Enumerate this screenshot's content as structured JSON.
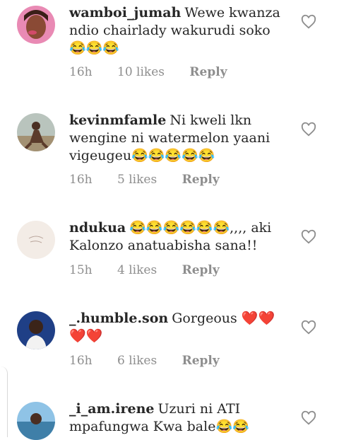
{
  "icons": {
    "like": "heart-outline-icon"
  },
  "comments": [
    {
      "username": "wamboi_jumah",
      "text": "Wewe kwanza ndio chairlady wakurudi soko 😂😂😂",
      "time": "16h",
      "likes": "10 likes",
      "reply": "Reply"
    },
    {
      "username": "kevinmfamle",
      "text": "Ni kweli lkn wengine ni watermelon yaani vigeugeu😂😂😂😂😂",
      "time": "16h",
      "likes": "5 likes",
      "reply": "Reply"
    },
    {
      "username": "ndukua",
      "text": "😂😂😂😂😂😂,,,, aki Kalonzo anatuabisha sana!!",
      "time": "15h",
      "likes": "4 likes",
      "reply": "Reply"
    },
    {
      "username": "_.humble.son",
      "text": "Gorgeous ❤️❤️❤️❤️",
      "time": "16h",
      "likes": "6 likes",
      "reply": "Reply"
    },
    {
      "username": "_i_am.irene",
      "text": "Uzuri ni ATI mpafungwa Kwa bale😂😂",
      "time": "",
      "likes": "",
      "reply": ""
    }
  ]
}
